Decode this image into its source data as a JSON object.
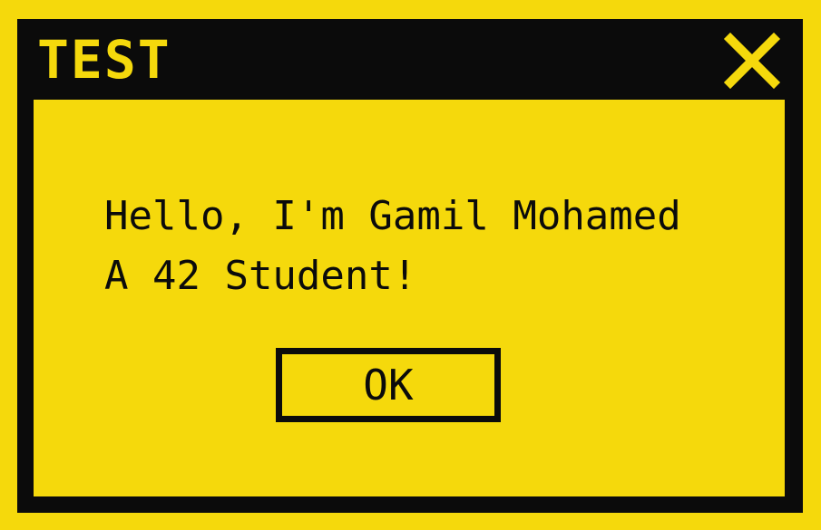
{
  "window": {
    "title": "TEST",
    "close_icon": "close-icon",
    "colors": {
      "background": "#f5d90c",
      "frame": "#0b0b0b",
      "text": "#0b0b0b"
    }
  },
  "message": {
    "line1": "Hello, I'm Gamil Mohamed",
    "line2": "A 42 Student!"
  },
  "buttons": {
    "ok_label": "OK"
  }
}
